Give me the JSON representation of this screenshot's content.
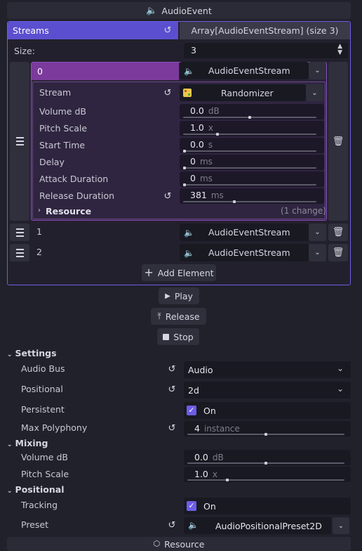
{
  "header": {
    "title": "AudioEvent"
  },
  "streams": {
    "label": "Streams",
    "array_label": "Array[AudioEventStream] (size 3)",
    "size_label": "Size:",
    "size_value": "3",
    "items": [
      {
        "index": "0",
        "type": "AudioEventStream"
      },
      {
        "index": "1",
        "type": "AudioEventStream"
      },
      {
        "index": "2",
        "type": "AudioEventStream"
      }
    ],
    "expanded": {
      "stream_label": "Stream",
      "stream_value": "Randomizer",
      "props": [
        {
          "label": "Volume dB",
          "value": "0.0",
          "unit": "dB",
          "fraction": 0.5
        },
        {
          "label": "Pitch Scale",
          "value": "1.0",
          "unit": "x",
          "fraction": 0.25
        },
        {
          "label": "Start Time",
          "value": "0.0",
          "unit": "s",
          "fraction": 0.0
        },
        {
          "label": "Delay",
          "value": "0",
          "unit": "ms",
          "fraction": 0.0
        },
        {
          "label": "Attack Duration",
          "value": "0",
          "unit": "ms",
          "fraction": 0.0
        },
        {
          "label": "Release Duration",
          "value": "381",
          "unit": "ms",
          "fraction": 0.38
        }
      ],
      "resource_label": "Resource",
      "resource_changes": "(1 change)"
    },
    "add_element": "Add Element"
  },
  "actions": {
    "play": "Play",
    "release": "Release",
    "stop": "Stop"
  },
  "settings": {
    "title": "Settings",
    "audio_bus_label": "Audio Bus",
    "audio_bus_value": "Audio",
    "positional_label": "Positional",
    "positional_value": "2d",
    "persistent_label": "Persistent",
    "persistent_value": "On",
    "max_poly_label": "Max Polyphony",
    "max_poly_value": "4",
    "max_poly_unit": "instance",
    "max_poly_fraction": 0.5
  },
  "mixing": {
    "title": "Mixing",
    "volume_label": "Volume dB",
    "volume_value": "0.0",
    "volume_unit": "dB",
    "volume_fraction": 0.5,
    "pitch_label": "Pitch Scale",
    "pitch_value": "1.0",
    "pitch_unit": "x",
    "pitch_fraction": 0.25
  },
  "positional": {
    "title": "Positional",
    "tracking_label": "Tracking",
    "tracking_value": "On",
    "preset_label": "Preset",
    "preset_value": "AudioPositionalPreset2D"
  },
  "footer": {
    "resource_label": "Resource"
  },
  "colors": {
    "accent": "#6c5ce7",
    "purple_header": "#7b3a9c",
    "panel_bg": "#2a2336"
  }
}
